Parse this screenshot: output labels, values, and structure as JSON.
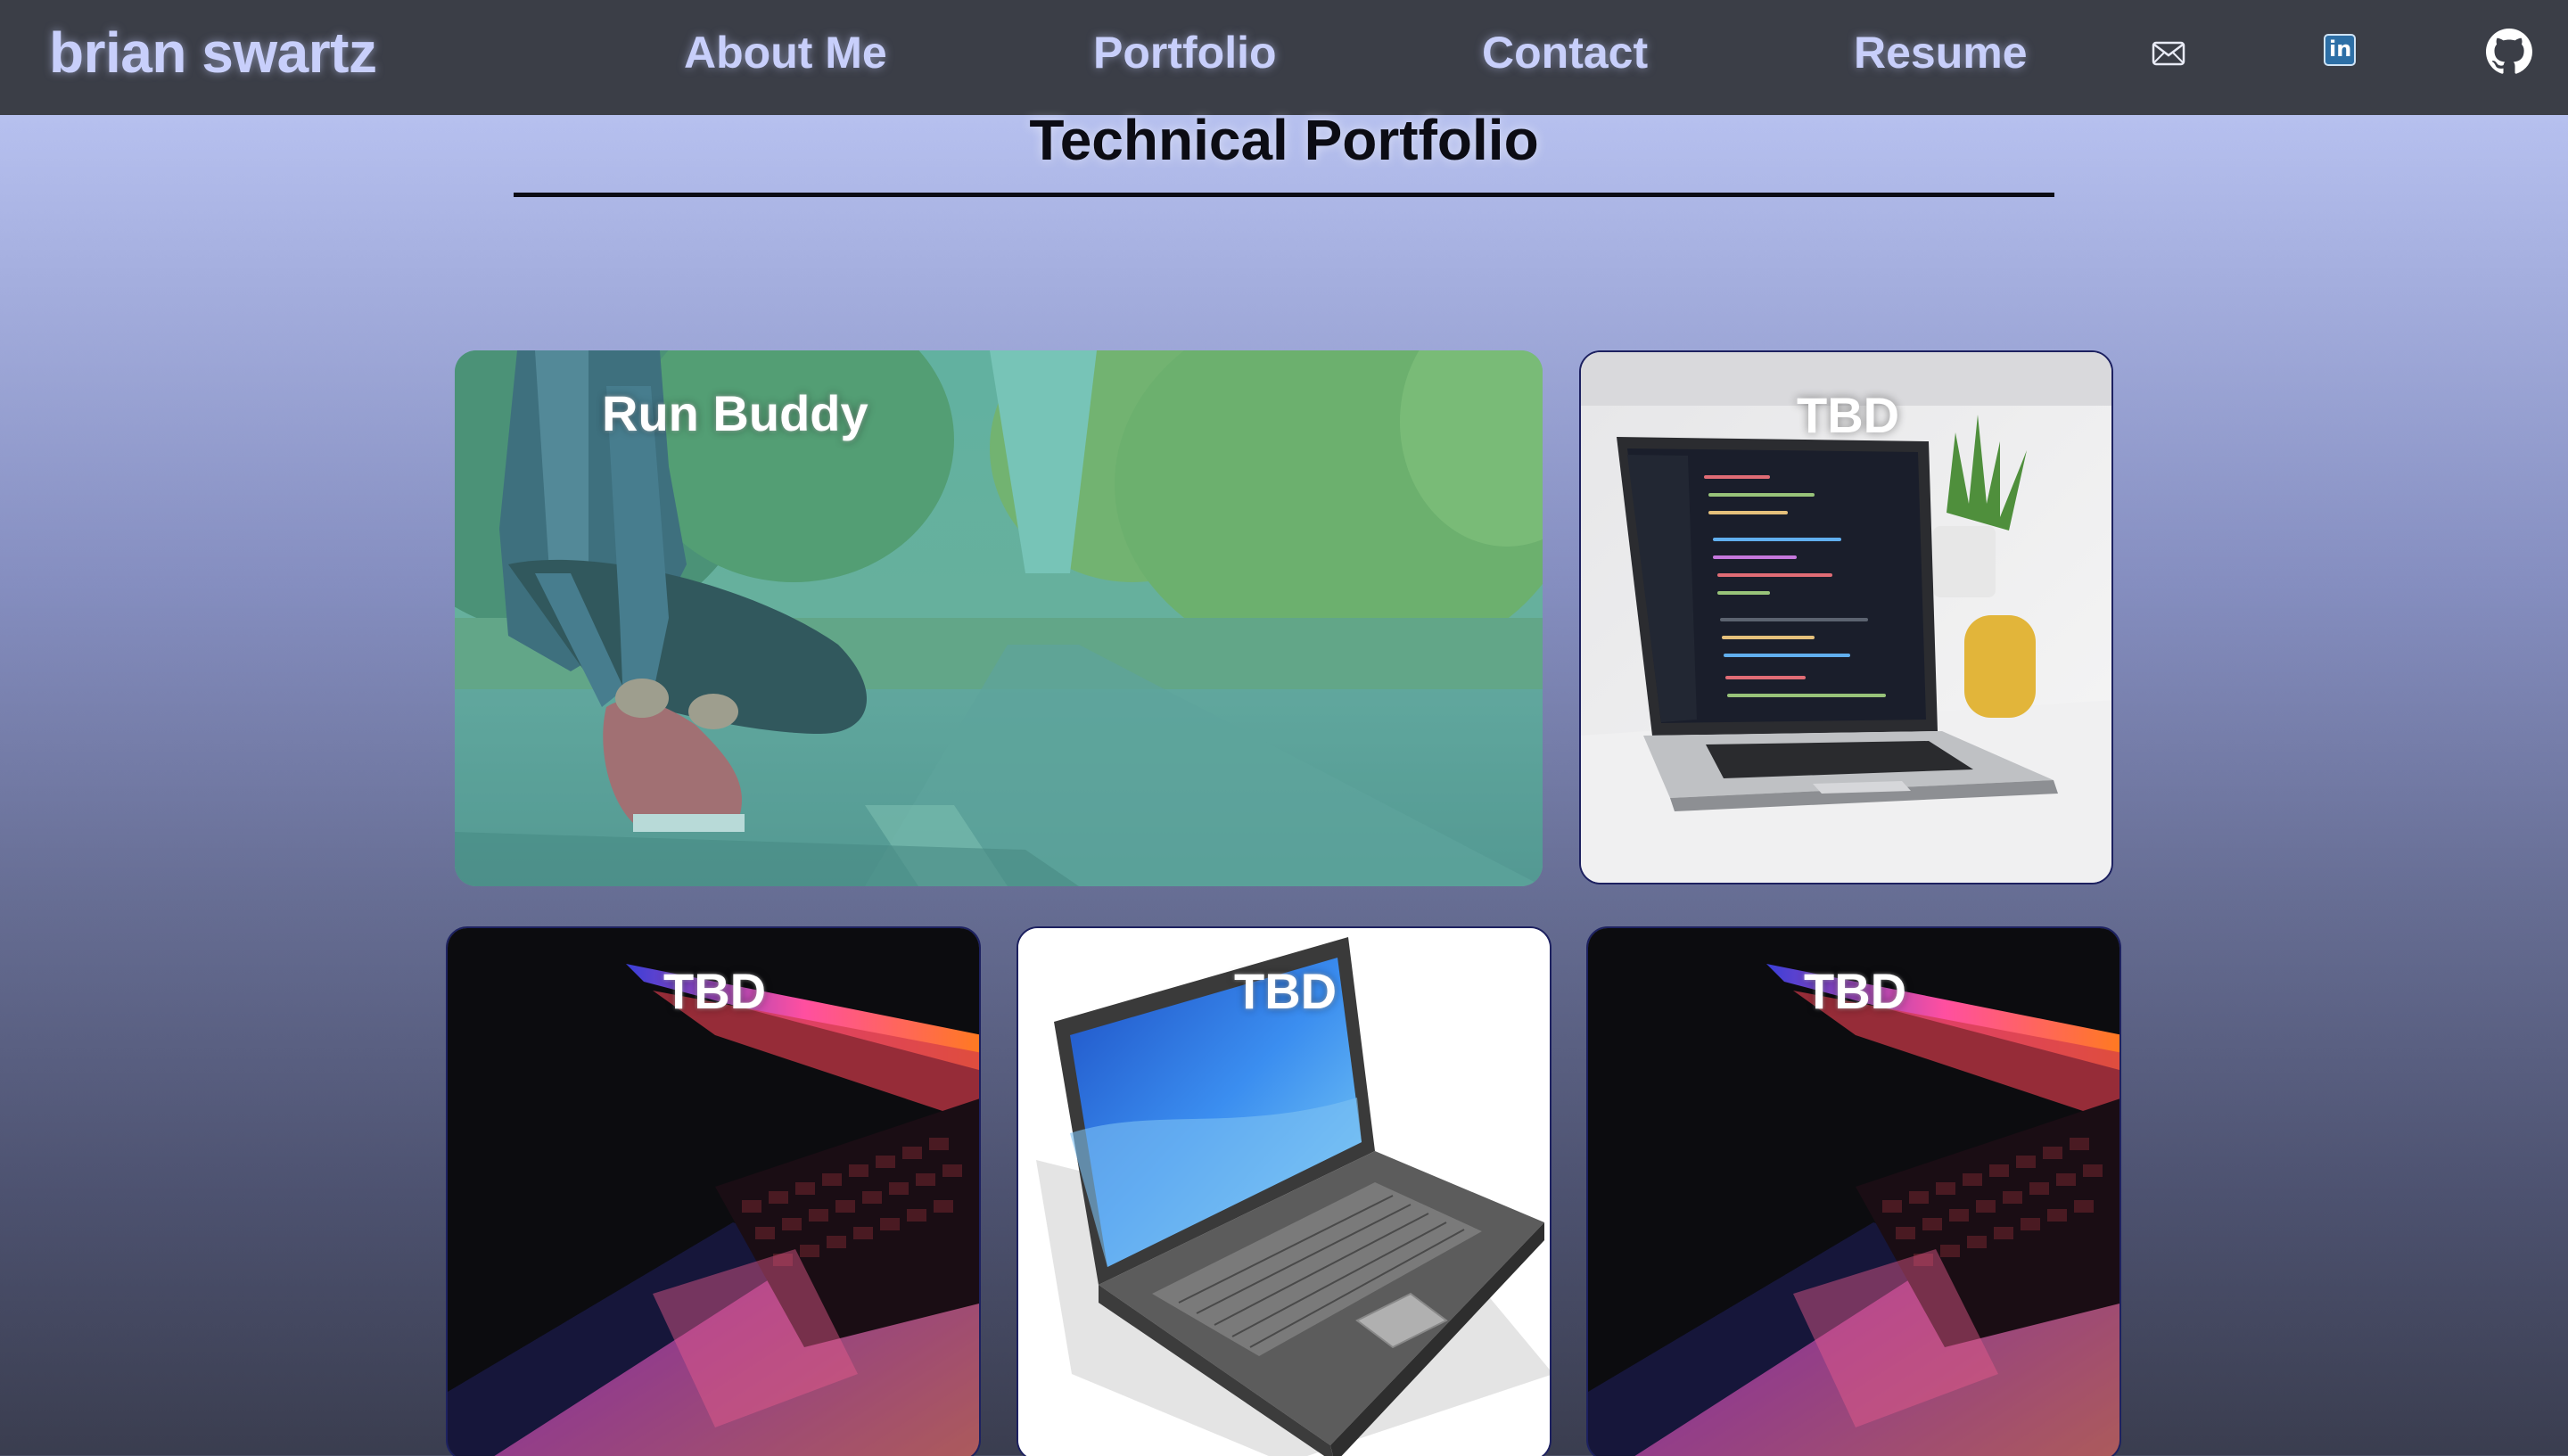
{
  "nav": {
    "brand": "brian swartz",
    "links": [
      {
        "label": "About Me"
      },
      {
        "label": "Portfolio"
      },
      {
        "label": "Contact"
      },
      {
        "label": "Resume"
      }
    ],
    "icons": [
      "mail-icon",
      "linkedin-icon",
      "github-icon"
    ],
    "linkedin_text": "in"
  },
  "main": {
    "title": "Technical Portfolio",
    "projects": [
      {
        "label": "Run Buddy",
        "image": "runner-tying-shoe-photo"
      },
      {
        "label": "TBD",
        "image": "laptop-code-photo"
      },
      {
        "label": "TBD",
        "image": "glowing-laptop-keyboard-photo"
      },
      {
        "label": "TBD",
        "image": "laptop-clipart"
      },
      {
        "label": "TBD",
        "image": "glowing-laptop-keyboard-photo"
      }
    ]
  },
  "colors": {
    "nav_bg": "#3b3e47",
    "nav_text": "#c8cffb",
    "card_border": "#1d2160",
    "gradient_top": "#c3cdfb",
    "gradient_bottom": "#3a3d4f"
  }
}
